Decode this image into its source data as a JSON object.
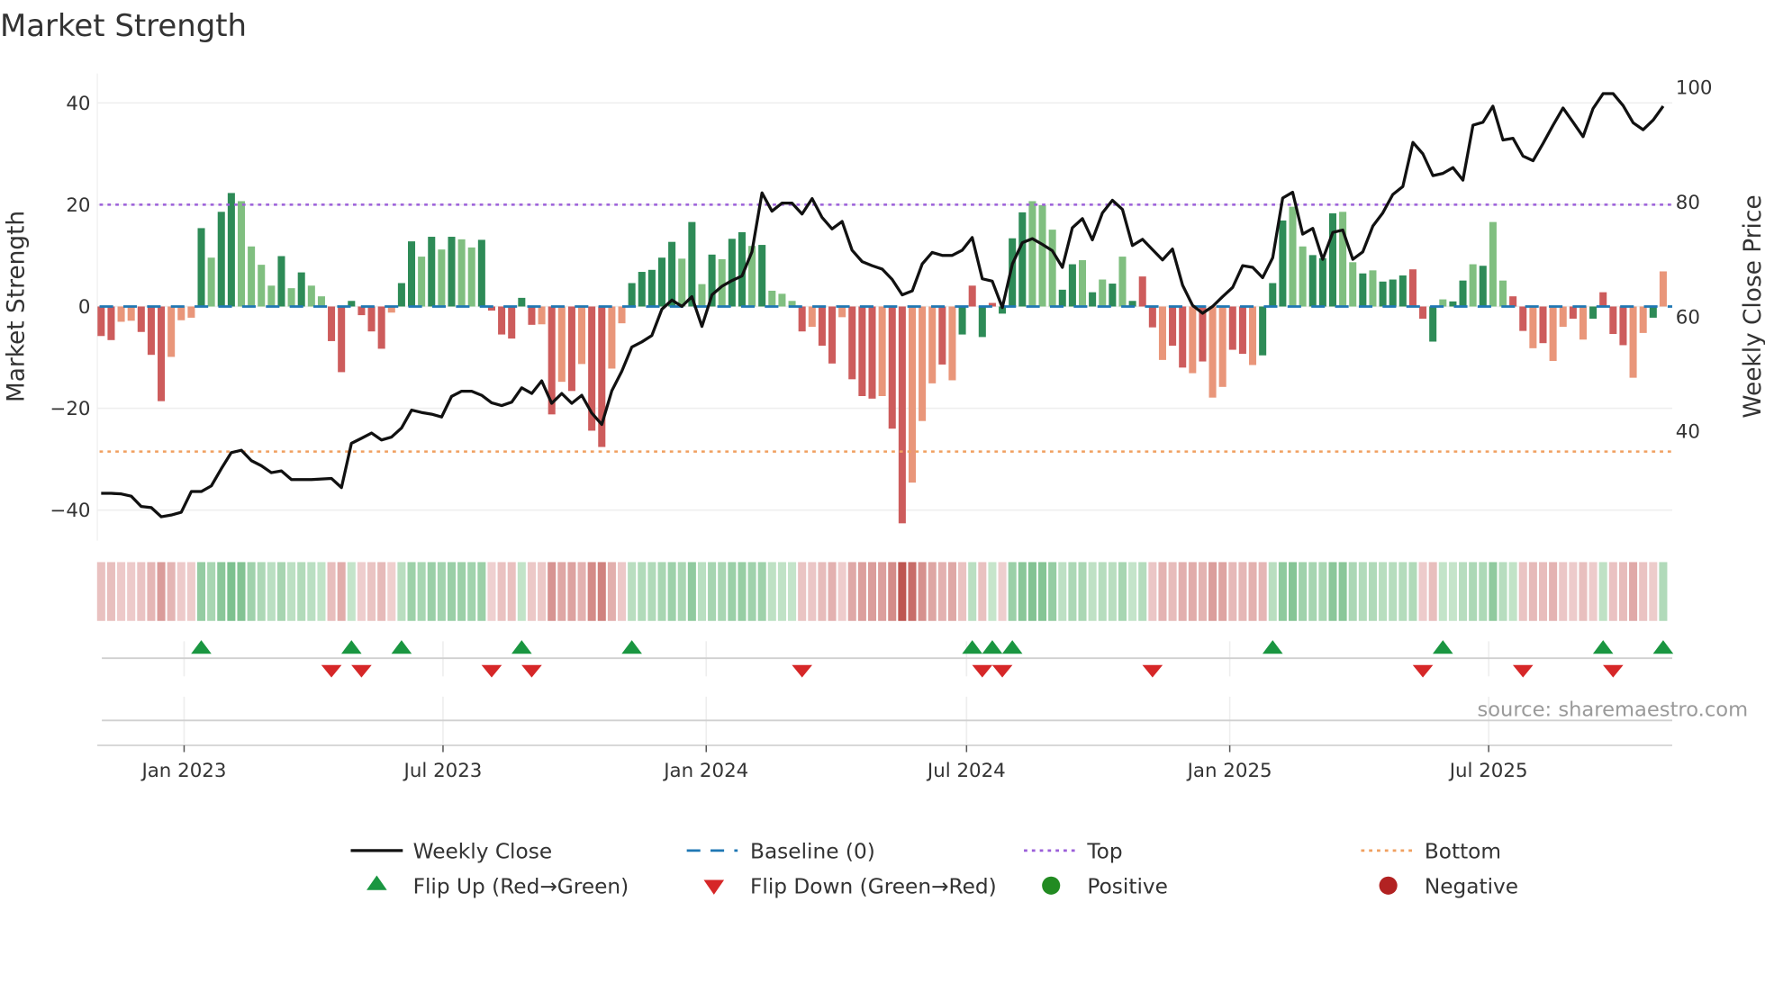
{
  "chart_data": {
    "type": "bar",
    "title": "Market Strength",
    "ylabel": "Market Strength",
    "y2label": "Weekly Close Price",
    "ylim": [
      -46,
      45
    ],
    "y2lim": [
      20,
      102
    ],
    "yticks": [
      40,
      20,
      0,
      -20,
      -40
    ],
    "y2ticks": [
      100,
      80,
      60,
      40
    ],
    "start_date": "2022-11-04",
    "frequency_days": 7,
    "xticks": [
      {
        "date": "2023-01-01",
        "label": "Jan 2023"
      },
      {
        "date": "2023-07-01",
        "label": "Jul 2023"
      },
      {
        "date": "2024-01-01",
        "label": "Jan 2024"
      },
      {
        "date": "2024-07-01",
        "label": "Jul 2024"
      },
      {
        "date": "2025-01-01",
        "label": "Jan 2025"
      },
      {
        "date": "2025-07-01",
        "label": "Jul 2025"
      }
    ],
    "top_threshold": 20,
    "bottom_threshold": -28.5,
    "baseline": 0,
    "strength": [
      -5.8,
      -6.6,
      -3.0,
      -2.8,
      -5.0,
      -9.5,
      -18.6,
      -9.9,
      -2.7,
      -2.2,
      15.4,
      9.6,
      18.6,
      22.3,
      20.7,
      11.8,
      8.2,
      4.1,
      9.9,
      3.6,
      6.7,
      4.1,
      2.0,
      -6.8,
      -12.9,
      1.1,
      -1.7,
      -4.9,
      -8.3,
      -1.2,
      4.6,
      12.8,
      9.8,
      13.7,
      11.2,
      13.7,
      13.2,
      11.6,
      13.1,
      -0.8,
      -5.5,
      -6.3,
      1.7,
      -3.6,
      -3.5,
      -21.2,
      -14.8,
      -16.6,
      -11.3,
      -24.4,
      -27.6,
      -12.2,
      -3.3,
      4.6,
      6.8,
      7.2,
      9.6,
      12.7,
      9.4,
      16.6,
      4.4,
      10.2,
      9.3,
      13.3,
      14.6,
      11.9,
      12.1,
      3.1,
      2.5,
      1.1,
      -4.9,
      -4.0,
      -7.7,
      -11.2,
      -2.1,
      -14.3,
      -17.6,
      -18.1,
      -17.6,
      -24.0,
      -42.6,
      -34.6,
      -22.5,
      -15.1,
      -11.4,
      -14.5,
      -5.5,
      4.1,
      -6.0,
      0.7,
      -1.4,
      13.4,
      18.5,
      20.7,
      19.9,
      15.1,
      3.3,
      8.3,
      9.1,
      2.8,
      5.3,
      4.5,
      9.8,
      1.1,
      5.9,
      -4.1,
      -10.5,
      -7.7,
      -12.0,
      -13.1,
      -10.8,
      -17.9,
      -15.8,
      -8.5,
      -9.3,
      -11.5,
      -9.6,
      4.6,
      16.9,
      19.6,
      11.8,
      10.1,
      9.5,
      18.3,
      18.6,
      8.7,
      6.5,
      7.1,
      4.9,
      5.3,
      6.1,
      7.3,
      -2.4,
      -6.9,
      1.4,
      1.0,
      5.1,
      8.3,
      8.0,
      16.6,
      5.1,
      2.0,
      -4.8,
      -8.2,
      -7.2,
      -10.7,
      -4.0,
      -2.4,
      -6.5,
      -2.4,
      2.8,
      -5.4,
      -7.6,
      -14.0,
      -5.2,
      -2.2,
      6.9
    ],
    "shade": "RRrrRRRrrrGgGGggggGgGggRRGRRRrGGgGgGggGRRRGRrRrRrRRrrGGGGGgGgGgGGgGgggRrRRrRRRrRRrrrRrGRGRGGGgggGGgGgGgGRRrRRrRrrRRrGGGggGGGggGgGGGRRGgGGgGggRRrRrrRrGRRRrrG",
    "weekly_close": [
      29.2,
      29.2,
      29.1,
      28.7,
      26.9,
      26.7,
      25.1,
      25.4,
      25.9,
      29.5,
      29.5,
      30.5,
      33.5,
      36.3,
      36.7,
      34.9,
      34.0,
      32.8,
      33.1,
      31.6,
      31.6,
      31.6,
      31.7,
      31.8,
      30.2,
      37.9,
      38.8,
      39.7,
      38.5,
      39.0,
      40.6,
      43.7,
      43.3,
      43.0,
      42.5,
      46.1,
      47.0,
      47.0,
      46.3,
      45.0,
      44.5,
      45.1,
      47.6,
      46.6,
      48.8,
      44.9,
      46.6,
      44.9,
      46.3,
      43.2,
      41.2,
      47.1,
      50.5,
      54.7,
      55.6,
      56.7,
      61.3,
      62.9,
      61.8,
      63.5,
      58.3,
      63.8,
      65.3,
      66.3,
      67.1,
      71.3,
      81.6,
      78.4,
      79.8,
      79.8,
      77.9,
      80.6,
      77.3,
      75.3,
      76.6,
      71.6,
      69.6,
      68.9,
      68.3,
      66.5,
      63.8,
      64.5,
      69.2,
      71.2,
      70.7,
      70.7,
      71.6,
      73.8,
      66.6,
      66.2,
      61.6,
      69.2,
      72.9,
      73.6,
      72.6,
      71.5,
      68.6,
      75.5,
      77.1,
      73.4,
      78.1,
      80.3,
      78.7,
      72.4,
      73.5,
      71.7,
      69.9,
      71.8,
      65.5,
      62.0,
      60.6,
      61.8,
      63.5,
      65.1,
      68.9,
      68.6,
      66.8,
      70.3,
      80.7,
      81.7,
      74.4,
      75.4,
      70.0,
      74.7,
      75.1,
      70.0,
      71.3,
      75.8,
      78.1,
      81.3,
      82.7,
      90.4,
      88.4,
      84.6,
      85.0,
      86.0,
      83.8,
      93.4,
      93.9,
      96.7,
      90.8,
      91.1,
      88.0,
      87.2,
      90.2,
      93.4,
      96.4,
      93.9,
      91.4,
      96.3,
      98.9,
      98.9,
      96.8,
      93.8,
      92.6,
      94.3,
      96.7
    ],
    "legend": {
      "weekly_close": "Weekly Close",
      "baseline": "Baseline (0)",
      "top": "Top",
      "bottom": "Bottom",
      "flip_up": "Flip Up (Red→Green)",
      "flip_down": "Flip Down (Green→Red)",
      "positive": "Positive",
      "negative": "Negative"
    },
    "legend_position": "bottom",
    "source": "source: sharemaestro.com",
    "colors": {
      "strong_green": "#2e8b57",
      "weak_green": "#80bf80",
      "strong_red": "#cd5c5c",
      "weak_red": "#e9967a",
      "top": "#9b5fd9",
      "bottom": "#f0a060",
      "baseline": "#1f77b4",
      "flip_up": "#1a9641",
      "flip_down": "#d62728",
      "positive": "#228b22",
      "negative": "#b22222"
    }
  }
}
